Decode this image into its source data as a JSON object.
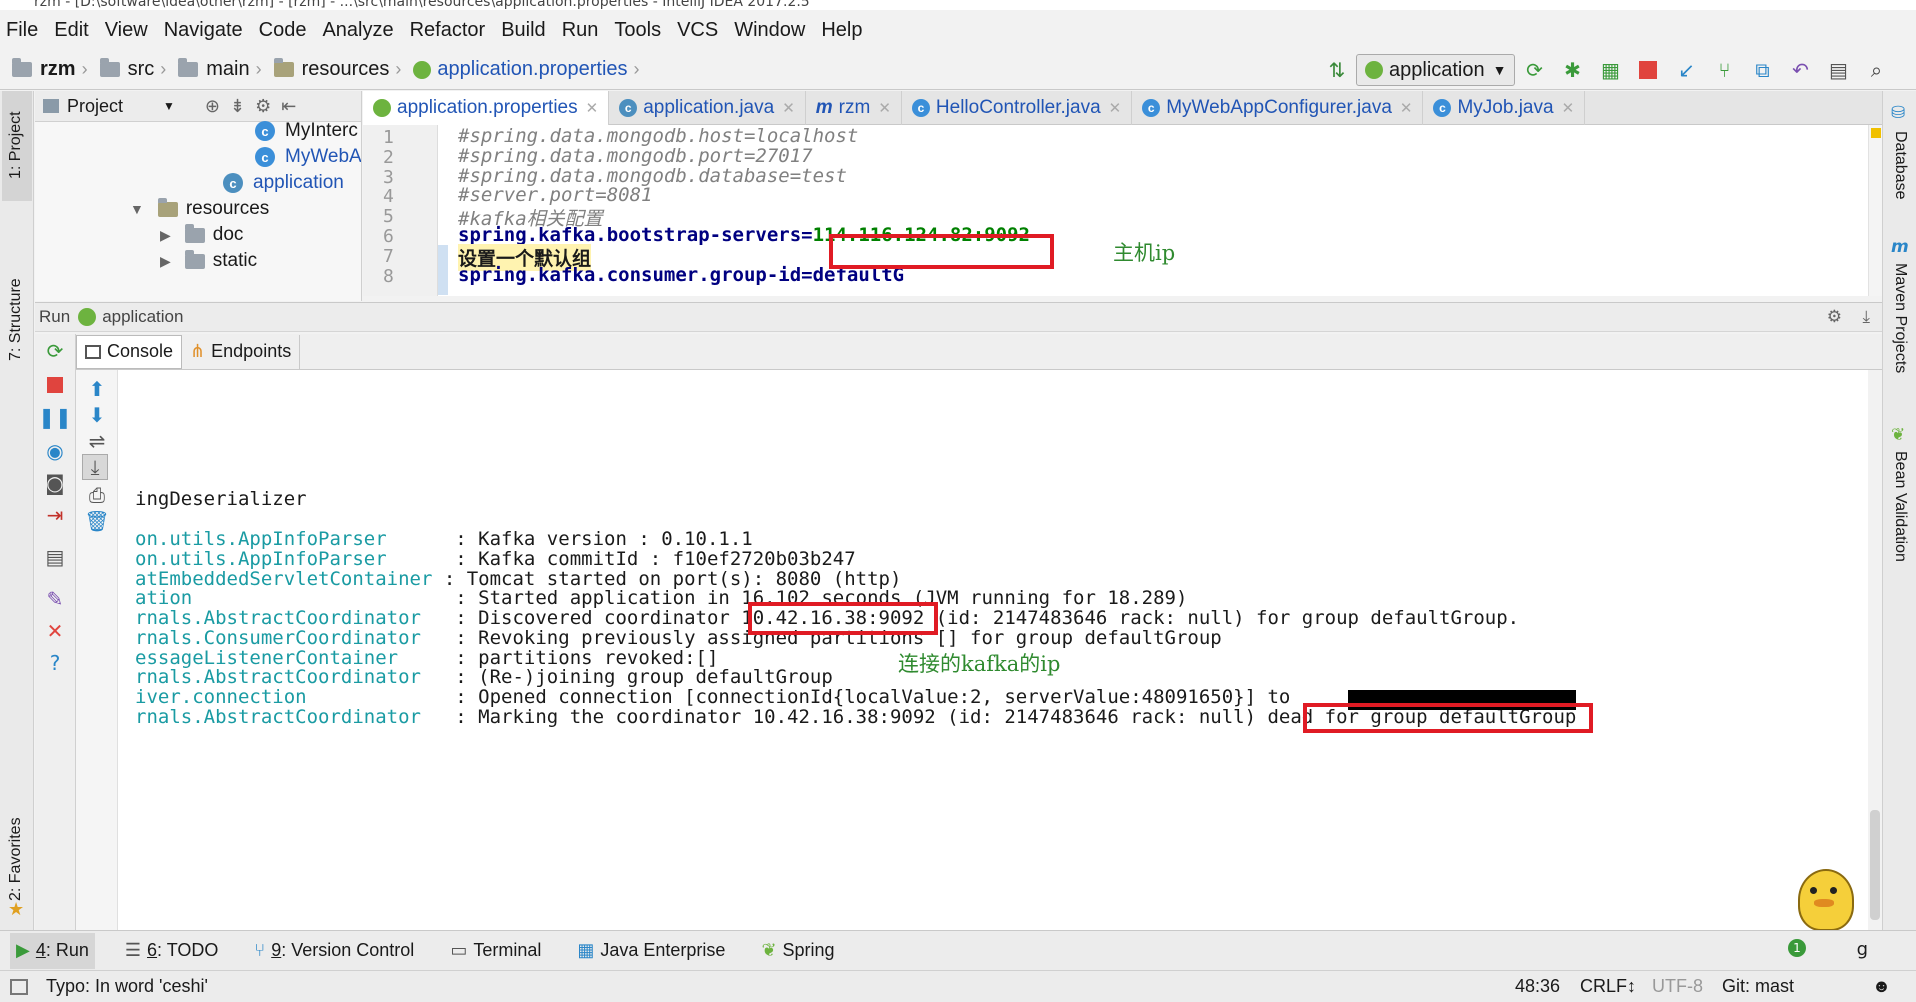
{
  "window": {
    "title": "rzm - [D:\\software\\idea\\other\\rzm] - [rzm] - ...\\src\\main\\resources\\application.properties - IntelliJ IDEA 2017.2.5"
  },
  "menu": [
    "File",
    "Edit",
    "View",
    "Navigate",
    "Code",
    "Analyze",
    "Refactor",
    "Build",
    "Run",
    "Tools",
    "VCS",
    "Window",
    "Help"
  ],
  "breadcrumb": [
    "rzm",
    "src",
    "main",
    "resources",
    "application.properties"
  ],
  "run_config": "application",
  "project_panel": {
    "title": "Project",
    "items": [
      {
        "label": "MyInterc",
        "type": "class"
      },
      {
        "label": "MyWebA",
        "type": "class"
      },
      {
        "label": "application",
        "type": "spring"
      },
      {
        "label": "resources",
        "type": "folder"
      },
      {
        "label": "doc",
        "type": "folder"
      },
      {
        "label": "static",
        "type": "folder"
      }
    ]
  },
  "editor_tabs": [
    {
      "label": "application.properties",
      "active": true
    },
    {
      "label": "application.java",
      "active": false
    },
    {
      "label": "rzm",
      "active": false
    },
    {
      "label": "HelloController.java",
      "active": false
    },
    {
      "label": "MyWebAppConfigurer.java",
      "active": false
    },
    {
      "label": "MyJob.java",
      "active": false
    }
  ],
  "editor": {
    "line_numbers": [
      "1",
      "2",
      "3",
      "4",
      "5",
      "6",
      "7",
      "8"
    ],
    "lines": {
      "l1": "#spring.data.mongodb.host=localhost",
      "l2": "#spring.data.mongodb.port=27017",
      "l3": "#spring.data.mongodb.database=test",
      "l4": "#server.port=8081",
      "l5": "#kafka相关配置",
      "l6_key": "spring.kafka.bootstrap-servers=",
      "l6_val": "114.116.124.82:9092",
      "l7": "设置一个默认组",
      "l8": "spring.kafka.consumer.group-id=defaultG"
    },
    "annotation": "主机ip"
  },
  "run_panel": {
    "label": "Run",
    "config": "application",
    "tabs": [
      "Console",
      "Endpoints"
    ]
  },
  "console": {
    "lines": [
      {
        "logger": "",
        "text": "ingDeserializer"
      },
      {
        "logger": "on.utils.AppInfoParser     ",
        "text": " : Kafka version : 0.10.1.1"
      },
      {
        "logger": "on.utils.AppInfoParser     ",
        "text": " : Kafka commitId : f10ef2720b03b247"
      },
      {
        "logger": "atEmbeddedServletContainer",
        "text": " : Tomcat started on port(s): 8080 (http)"
      },
      {
        "logger": "ation                      ",
        "text": " : Started application in 16.102 seconds (JVM running for 18.289)"
      },
      {
        "logger": "rnals.AbstractCoordinator  ",
        "text": " : Discovered coordinator 10.42.16.38:9092 (id: 2147483646 rack: null) for group defaultGroup."
      },
      {
        "logger": "rnals.ConsumerCoordinator  ",
        "text": " : Revoking previously assigned partitions [] for group defaultGroup"
      },
      {
        "logger": "essageListenerContainer    ",
        "text": " : partitions revoked:[]"
      },
      {
        "logger": "rnals.AbstractCoordinator  ",
        "text": " : (Re-)joining group defaultGroup"
      },
      {
        "logger": "iver.connection            ",
        "text": " : Opened connection [connectionId{localValue:2, serverValue:48091650}] to"
      },
      {
        "logger": "rnals.AbstractCoordinator  ",
        "text": " : Marking the coordinator 10.42.16.38:9092 (id: 2147483646 rack: null) dead for group defaultGroup"
      }
    ],
    "annotation": "连接的kafka的ip"
  },
  "left_tools": {
    "project": "1: Project",
    "structure": "7: Structure",
    "favorites": "2: Favorites"
  },
  "right_tools": {
    "database": "Database",
    "maven": "Maven Projects",
    "bean": "Bean Validation"
  },
  "bottom_tools": [
    {
      "num": "4",
      "label": ": Run",
      "active": true
    },
    {
      "num": "6",
      "label": ": TODO",
      "active": false
    },
    {
      "num": "9",
      "label": ": Version Control",
      "active": false
    },
    {
      "num": "",
      "label": "Terminal",
      "active": false
    },
    {
      "num": "",
      "label": "Java Enterprise",
      "active": false
    },
    {
      "num": "",
      "label": "Spring",
      "active": false
    }
  ],
  "status": {
    "message": "Typo: In word 'ceshi'",
    "position": "48:36",
    "line_sep": "CRLF↕",
    "encoding": "UTF-8",
    "git": "Git: mast",
    "event_badge": "1",
    "event_suffix": "g"
  }
}
